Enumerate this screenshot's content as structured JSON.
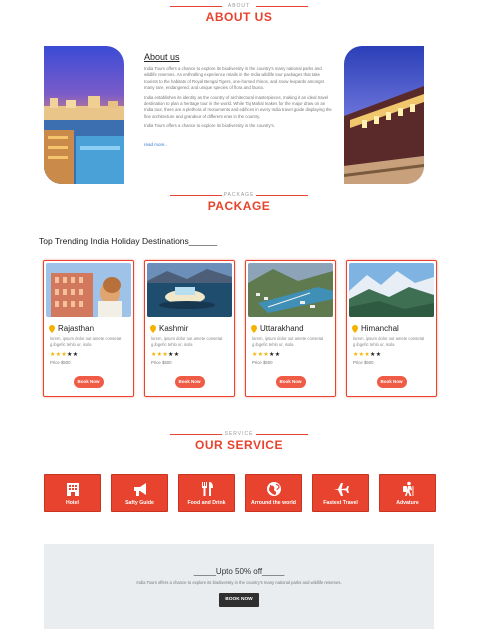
{
  "about": {
    "kicker": "ABOUT",
    "title": "ABOUT US",
    "heading": "About us",
    "paragraph1": "India Tours offers a chance to explore its biodiversity in the country's many national parks and wildlife reserves. An enthralling experience retails in the India wildlife tour packages that take tourists to the habitats of Royal Bengal Tigers, one-horned rhinos, and snow leopards amongst many rare, endangered, and unique species of flora and fauna.",
    "paragraph2": "India establishes its identity as the country of architectural masterpieces, making it an ideal travel destination to plan a heritage tour in the world. While Taj Mahal makes for the major draw on an India tour, there are a plethora of monuments and edifices in every India travel guide displaying the fine architecture and grandeur of different eras in the country.",
    "paragraph3": "India Tours offers a chance to explore its biodiversity in the country's.",
    "read_more": "read more.."
  },
  "package": {
    "kicker": "PACKAGE",
    "title": "PACKAGE",
    "trending_title": "Top Trending India Holiday Destinations______",
    "cards": [
      {
        "name": "Rajasthan",
        "desc": "lorem, ipsum dolor out amete consetat g.ibgefic tehlo ur, isola",
        "rating": 3,
        "price": "Price $500",
        "button": "Book Now"
      },
      {
        "name": "Kashmir",
        "desc": "lorem, ipsum dolor out amete consetat g.ibgefic tehlo ur, isola",
        "rating": 3,
        "price": "Price $500",
        "button": "Book Now"
      },
      {
        "name": "Uttarakhand",
        "desc": "lorem, ipsum dolor out amete consetat g.ibgefic tehlo ur, isola",
        "rating": 3,
        "price": "Price $500",
        "button": "Book Now"
      },
      {
        "name": "Himanchal",
        "desc": "lorem, ipsum dolor out amete consetat g.ibgefic tehlo ur, isola",
        "rating": 3,
        "price": "Price $500",
        "button": "Book Now"
      }
    ]
  },
  "service": {
    "kicker": "SERVICE",
    "title": "OUR SERVICE",
    "items": [
      {
        "label": "Hotel",
        "icon": "hotel-icon"
      },
      {
        "label": "Safty Guide",
        "icon": "megaphone-icon"
      },
      {
        "label": "Food and Drink",
        "icon": "fork-knife-icon"
      },
      {
        "label": "Arround the world",
        "icon": "globe-icon"
      },
      {
        "label": "Fastest Travel",
        "icon": "airplane-icon"
      },
      {
        "label": "Advature",
        "icon": "hiker-icon"
      }
    ]
  },
  "offer": {
    "title": "_____Upto 50% off_____",
    "desc": "India Tours offers a chance to explore its biodiversity in the country's many national parks and wildlife reserves.",
    "button": "BOOK NOW"
  },
  "colors": {
    "accent": "#e8432e",
    "button": "#ef5b45",
    "dark_button": "#2f2f2f",
    "offer_bg": "#e9edf0",
    "star": "#f5b301"
  }
}
